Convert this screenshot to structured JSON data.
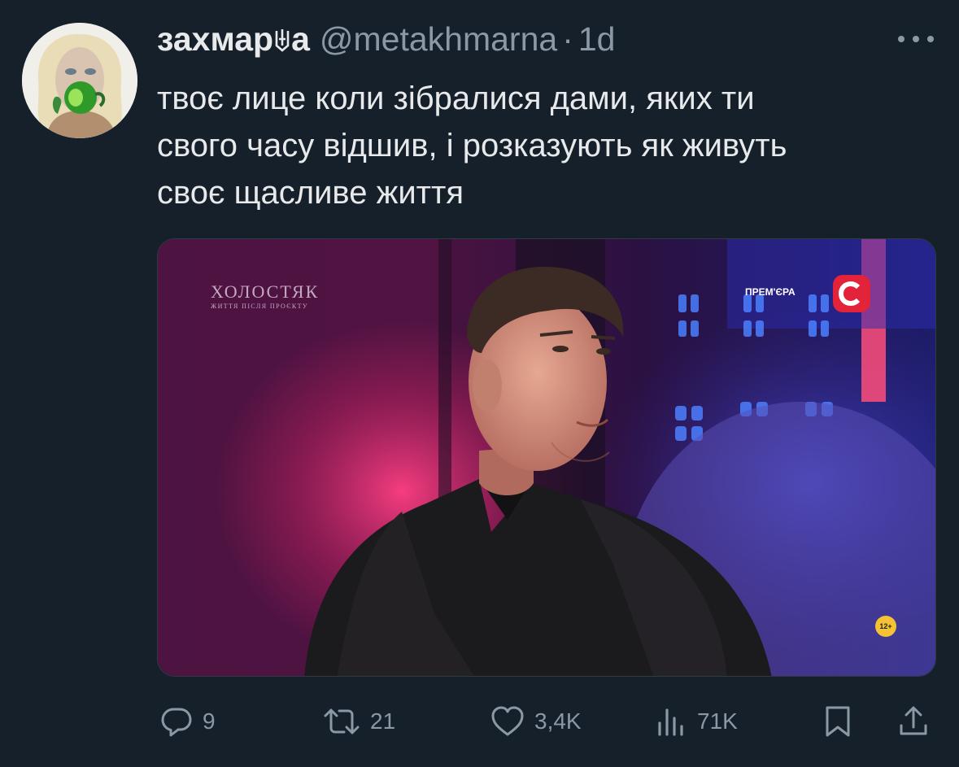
{
  "tweet": {
    "display_name": "захмар",
    "display_name_tail": "а",
    "handle": "@metakhmarna",
    "separator": "·",
    "time": "1d",
    "text": "твоє лице коли зібралися дами, яких ти\nсвого часу відшив, і розказують як живуть\nсвоє щасливе життя"
  },
  "media": {
    "show_title": "ХОЛОСТЯК",
    "show_subtitle": "ЖИТТЯ ПІСЛЯ ПРОЄКТУ",
    "premiere_label": "ПРЕМ'ЄРА",
    "age_rating": "12+"
  },
  "actions": {
    "replies": "9",
    "reposts": "21",
    "likes": "3,4K",
    "views": "71K"
  },
  "icons": {
    "more": "more-icon",
    "reply": "reply-icon",
    "repost": "repost-icon",
    "like": "like-icon",
    "views": "views-icon",
    "bookmark": "bookmark-icon",
    "share": "share-icon"
  },
  "colors": {
    "background": "#15202b",
    "text": "#e7e9ea",
    "secondary": "#8b98a5",
    "channel_logo": "#e2233a"
  }
}
